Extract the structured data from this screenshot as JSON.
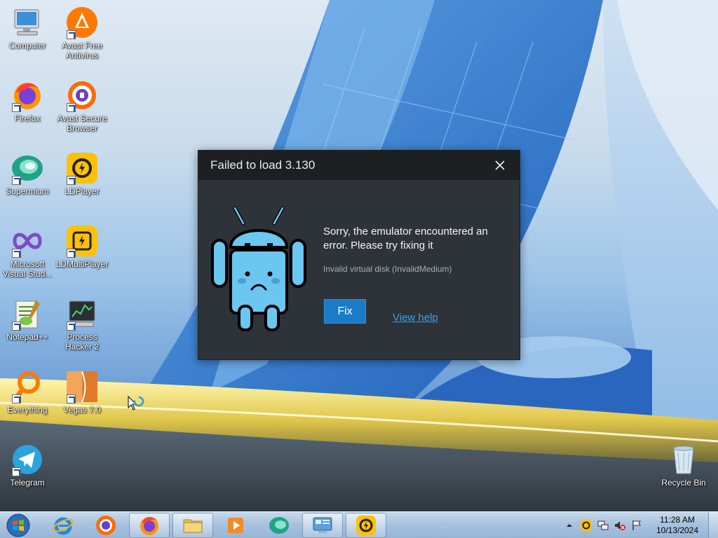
{
  "desktop": {
    "icons": [
      {
        "label": "Computer"
      },
      {
        "label": "Avast Free Antivirus"
      },
      {
        "label": "Firefox"
      },
      {
        "label": "Avast Secure Browser"
      },
      {
        "label": "Supermium"
      },
      {
        "label": "LDPlayer"
      },
      {
        "label": "Microsoft Visual Stud..."
      },
      {
        "label": "LDMultiPlayer"
      },
      {
        "label": "Notepad++"
      },
      {
        "label": "Process Hacker 2"
      },
      {
        "label": "Everything"
      },
      {
        "label": "Vegas 7.0"
      },
      {
        "label": "Telegram"
      },
      {
        "label": "Recycle Bin"
      }
    ]
  },
  "dialog": {
    "title": "Failed to load 3.130",
    "message": "Sorry, the emulator encountered an error. Please try fixing it",
    "detail": "Invalid virtual disk (InvalidMedium)",
    "fix_label": "Fix",
    "help_label": "View help"
  },
  "taskbar": {
    "items": [
      "Internet Explorer",
      "Avast Secure Browser",
      "Firefox",
      "Windows Explorer",
      "Media Player",
      "Supermium",
      "Control Panel",
      "LDPlayer"
    ],
    "clock": {
      "time": "11:28 AM",
      "date": "10/13/2024"
    }
  },
  "colors": {
    "dialog_bg": "#2e333a",
    "dialog_header": "#1d1f23",
    "accent": "#1a7bc7",
    "link": "#3aa0ec"
  }
}
